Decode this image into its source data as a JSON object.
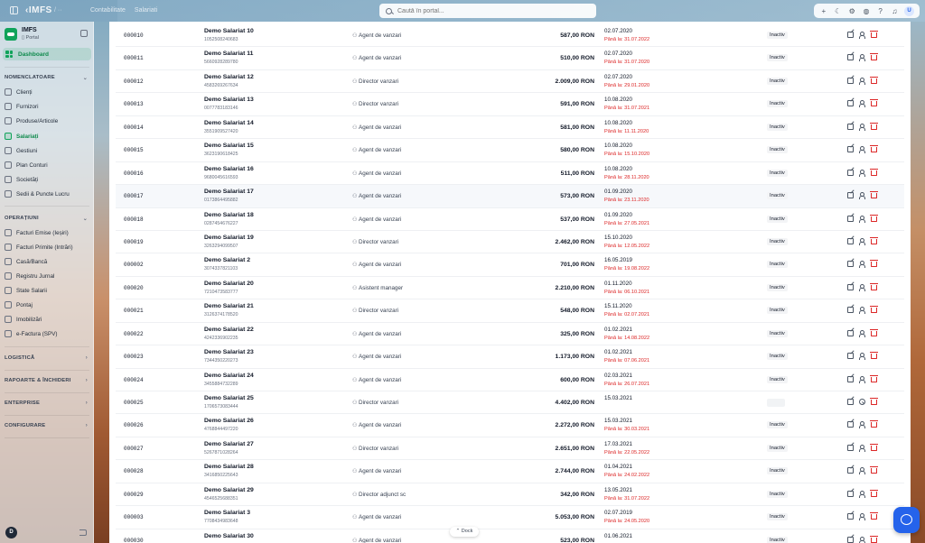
{
  "topbar": {
    "brand": "‹IMFS",
    "brand_sub": "/ ··",
    "crumbs": [
      "Contabilitate",
      "Salariati"
    ],
    "search_placeholder": "Caută în portal...",
    "avatar_initial": "U"
  },
  "sidebar": {
    "title": "IMFS",
    "subtitle": "▯ Portal",
    "dashboard": "Dashboard",
    "sections": {
      "nomenclatoare": "NOMENCLATOARE",
      "operatiuni": "OPERAȚIUNI",
      "logistica": "LOGISTICĂ",
      "rapoarte": "RAPOARTE & ÎNCHIDERI",
      "enterprise": "ENTERPRISE",
      "configurare": "CONFIGURARE"
    },
    "nomenclatoare_items": [
      "Clienți",
      "Furnizori",
      "Produse/Articole",
      "Salariați",
      "Gestiuni",
      "Plan Conturi",
      "Societăți",
      "Sedii & Puncte Lucru"
    ],
    "operatiuni_items": [
      "Facturi Emise (Ieșiri)",
      "Facturi Primite (Intrări)",
      "Casă/Bancă",
      "Registru Jurnal",
      "State Salarii",
      "Pontaj",
      "Imobilizări",
      "e-Factura (SPV)"
    ],
    "user_initial": "D"
  },
  "table": {
    "rows": [
      {
        "code": "000010",
        "name": "Demo Salariat 10",
        "cnp": "1052508240683",
        "role": "Agent de vanzari",
        "amount": "587,00 RON",
        "date": "02.07.2020",
        "until": "Până la: 31.07.2022",
        "status": "Inactiv"
      },
      {
        "code": "000011",
        "name": "Demo Salariat 11",
        "cnp": "5660928289780",
        "role": "Agent de vanzari",
        "amount": "510,00 RON",
        "date": "02.07.2020",
        "until": "Până la: 31.07.2020",
        "status": "Inactiv"
      },
      {
        "code": "000012",
        "name": "Demo Salariat 12",
        "cnp": "4583269267634",
        "role": "Director vanzari",
        "amount": "2.009,00 RON",
        "date": "02.07.2020",
        "until": "Până la: 29.01.2020",
        "status": "Inactiv"
      },
      {
        "code": "000013",
        "name": "Demo Salariat 13",
        "cnp": "0077783183146",
        "role": "Director vanzari",
        "amount": "591,00 RON",
        "date": "10.08.2020",
        "until": "Până la: 31.07.2021",
        "status": "Inactiv"
      },
      {
        "code": "000014",
        "name": "Demo Salariat 14",
        "cnp": "3551909527420",
        "role": "Agent de vanzari",
        "amount": "581,00 RON",
        "date": "10.08.2020",
        "until": "Până la: 11.11.2020",
        "status": "Inactiv"
      },
      {
        "code": "000015",
        "name": "Demo Salariat 15",
        "cnp": "3623190618425",
        "role": "Agent de vanzari",
        "amount": "580,00 RON",
        "date": "10.08.2020",
        "until": "Până la: 15.10.2020",
        "status": "Inactiv"
      },
      {
        "code": "000016",
        "name": "Demo Salariat 16",
        "cnp": "9680045616593",
        "role": "Agent de vanzari",
        "amount": "511,00 RON",
        "date": "10.08.2020",
        "until": "Până la: 28.11.2020",
        "status": "Inactiv"
      },
      {
        "code": "000017",
        "name": "Demo Salariat 17",
        "cnp": "0173864495882",
        "role": "Agent de vanzari",
        "amount": "573,00 RON",
        "date": "01.09.2020",
        "until": "Până la: 23.11.2020",
        "status": "Inactiv"
      },
      {
        "code": "000018",
        "name": "Demo Salariat 18",
        "cnp": "0287454676227",
        "role": "Agent de vanzari",
        "amount": "537,00 RON",
        "date": "01.09.2020",
        "until": "Până la: 27.05.2021",
        "status": "Inactiv"
      },
      {
        "code": "000019",
        "name": "Demo Salariat 19",
        "cnp": "3263294099507",
        "role": "Director vanzari",
        "amount": "2.462,00 RON",
        "date": "15.10.2020",
        "until": "Până la: 12.05.2022",
        "status": "Inactiv"
      },
      {
        "code": "000002",
        "name": "Demo Salariat 2",
        "cnp": "3074337821103",
        "role": "Agent de vanzari",
        "amount": "701,00 RON",
        "date": "16.05.2019",
        "until": "Până la: 19.08.2022",
        "status": "Inactiv"
      },
      {
        "code": "000020",
        "name": "Demo Salariat 20",
        "cnp": "7210473583777",
        "role": "Asistent manager",
        "amount": "2.210,00 RON",
        "date": "01.11.2020",
        "until": "Până la: 06.10.2021",
        "status": "Inactiv"
      },
      {
        "code": "000021",
        "name": "Demo Salariat 21",
        "cnp": "3126374178520",
        "role": "Director vanzari",
        "amount": "548,00 RON",
        "date": "15.11.2020",
        "until": "Până la: 02.07.2021",
        "status": "Inactiv"
      },
      {
        "code": "000022",
        "name": "Demo Salariat 22",
        "cnp": "4242336902235",
        "role": "Agent de vanzari",
        "amount": "325,00 RON",
        "date": "01.02.2021",
        "until": "Până la: 14.08.2022",
        "status": "Inactiv"
      },
      {
        "code": "000023",
        "name": "Demo Salariat 23",
        "cnp": "7344350220273",
        "role": "Agent de vanzari",
        "amount": "1.173,00 RON",
        "date": "01.02.2021",
        "until": "Până la: 07.06.2021",
        "status": "Inactiv"
      },
      {
        "code": "000024",
        "name": "Demo Salariat 24",
        "cnp": "3455884732289",
        "role": "Agent de vanzari",
        "amount": "600,00 RON",
        "date": "02.03.2021",
        "until": "Până la: 26.07.2021",
        "status": "Inactiv"
      },
      {
        "code": "000025",
        "name": "Demo Salariat 25",
        "cnp": "1706573083444",
        "role": "Director vanzari",
        "amount": "4.402,00 RON",
        "date": "15.03.2021",
        "until": "",
        "status": ""
      },
      {
        "code": "000026",
        "name": "Demo Salariat 26",
        "cnp": "4768844497220",
        "role": "Agent de vanzari",
        "amount": "2.272,00 RON",
        "date": "15.03.2021",
        "until": "Până la: 30.03.2021",
        "status": "Inactiv"
      },
      {
        "code": "000027",
        "name": "Demo Salariat 27",
        "cnp": "5267871028264",
        "role": "Director vanzari",
        "amount": "2.651,00 RON",
        "date": "17.03.2021",
        "until": "Până la: 22.05.2022",
        "status": "Inactiv"
      },
      {
        "code": "000028",
        "name": "Demo Salariat 28",
        "cnp": "3416850225643",
        "role": "Agent de vanzari",
        "amount": "2.744,00 RON",
        "date": "01.04.2021",
        "until": "Până la: 24.02.2022",
        "status": "Inactiv"
      },
      {
        "code": "000029",
        "name": "Demo Salariat 29",
        "cnp": "4546525688351",
        "role": "Director adjunct sc",
        "amount": "342,00 RON",
        "date": "13.05.2021",
        "until": "Până la: 31.07.2022",
        "status": "Inactiv"
      },
      {
        "code": "000003",
        "name": "Demo Salariat 3",
        "cnp": "7708434983648",
        "role": "Agent de vanzari",
        "amount": "5.053,00 RON",
        "date": "02.07.2019",
        "until": "Până la: 24.05.2020",
        "status": "Inactiv"
      },
      {
        "code": "000030",
        "name": "Demo Salariat 30",
        "cnp": "",
        "role": "Agent de vanzari",
        "amount": "523,00 RON",
        "date": "01.06.2021",
        "until": "",
        "status": "Inactiv"
      }
    ]
  },
  "dock_label": "⌃ Dock"
}
